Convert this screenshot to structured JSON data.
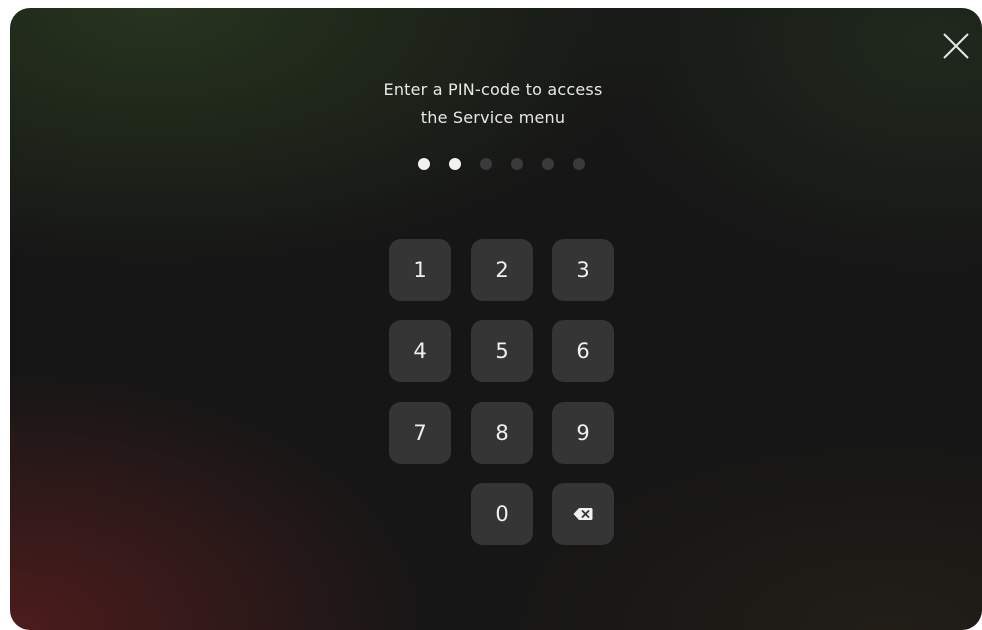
{
  "prompt": {
    "line1": "Enter a PIN-code to access",
    "line2": "the Service menu"
  },
  "pin": {
    "length": 6,
    "entered": 2
  },
  "keypad": {
    "keys": [
      "1",
      "2",
      "3",
      "4",
      "5",
      "6",
      "7",
      "8",
      "9",
      "0"
    ],
    "backspace_icon": "backspace-icon"
  },
  "icons": {
    "close": "close-icon",
    "backspace": "backspace-icon"
  },
  "colors": {
    "key_background": "#353535",
    "dot_filled": "#f2f2f2",
    "dot_empty": "#3a3a3a",
    "text": "#e8e8e8"
  }
}
